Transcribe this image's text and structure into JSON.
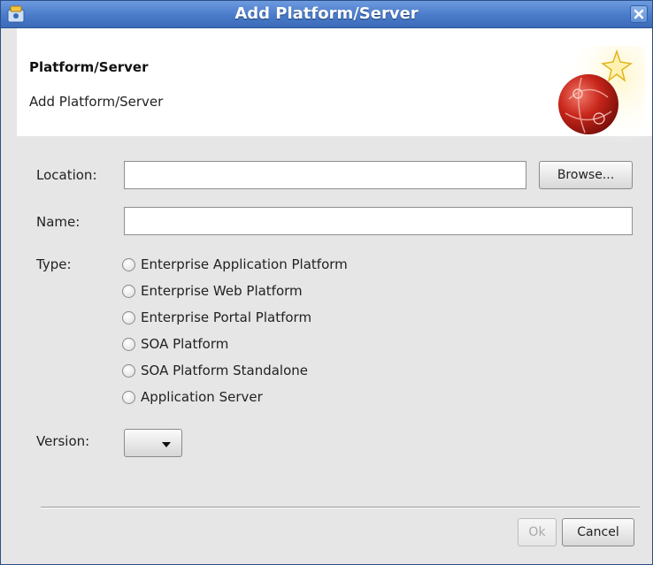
{
  "window": {
    "title": "Add Platform/Server"
  },
  "banner": {
    "title": "Platform/Server",
    "description": "Add Platform/Server"
  },
  "form": {
    "location_label": "Location:",
    "location_value": "",
    "browse_label": "Browse...",
    "name_label": "Name:",
    "name_value": "",
    "type_label": "Type:",
    "types": [
      "Enterprise Application Platform",
      "Enterprise Web Platform",
      "Enterprise Portal Platform",
      "SOA Platform",
      "SOA Platform Standalone",
      "Application Server"
    ],
    "version_label": "Version:",
    "version_value": ""
  },
  "footer": {
    "ok_label": "Ok",
    "cancel_label": "Cancel"
  },
  "colors": {
    "titlebar": "#4a7bc9",
    "dialog_bg": "#e6e6e6",
    "banner_bg": "#ffffff"
  }
}
